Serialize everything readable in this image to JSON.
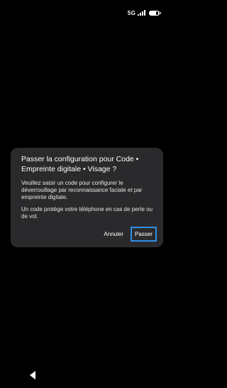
{
  "status_bar": {
    "network": "5G",
    "signal_icon": "signal-bars-icon",
    "battery_icon": "battery-icon"
  },
  "dialog": {
    "title": "Passer la configuration pour Code • Empreinte digitale • Visage ?",
    "body_1": "Veuillez saisir un code pour configurer le déverrouillage par reconnaissance faciale et par empreinte digitale.",
    "body_2": "Un code protège votre téléphone en cas de perte ou de vol.",
    "cancel_label": "Annuler",
    "skip_label": "Passer"
  },
  "nav_bar": {
    "back_icon": "back-triangle-icon"
  },
  "colors": {
    "background": "#000000",
    "dialog_bg": "#2a2a2c",
    "focus_outline": "#2f8fe6",
    "text": "#ffffff"
  }
}
